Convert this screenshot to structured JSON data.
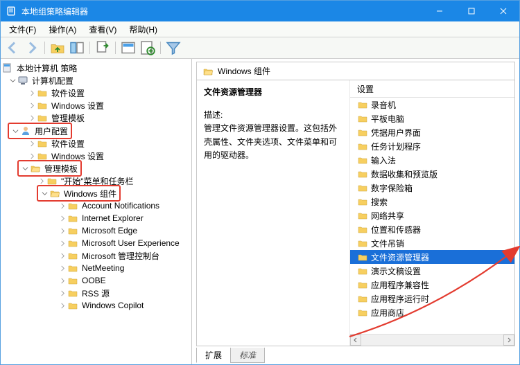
{
  "title": "本地组策略编辑器",
  "menu": {
    "file": "文件(F)",
    "action": "操作(A)",
    "view": "查看(V)",
    "help": "帮助(H)"
  },
  "tree": {
    "root": "本地计算机 策略",
    "computer": "计算机配置",
    "c_software": "软件设置",
    "c_windows": "Windows 设置",
    "c_admin": "管理模板",
    "user": "用户配置",
    "u_software": "软件设置",
    "u_windows": "Windows 设置",
    "u_admin": "管理模板",
    "start": "\"开始\"菜单和任务栏",
    "wincomp": "Windows 组件",
    "items": [
      "Account Notifications",
      "Internet Explorer",
      "Microsoft Edge",
      "Microsoft User Experience",
      "Microsoft 管理控制台",
      "NetMeeting",
      "OOBE",
      "RSS 源",
      "Windows Copilot"
    ]
  },
  "right": {
    "heading": "Windows 组件",
    "strong": "文件资源管理器",
    "desc_label": "描述:",
    "desc_text": "管理文件资源管理器设置。这包括外壳属性、文件夹选项、文件菜单和可用的驱动器。",
    "col": "设置",
    "selected_index": 11,
    "items": [
      "录音机",
      "平板电脑",
      "凭据用户界面",
      "任务计划程序",
      "输入法",
      "数据收集和预览版",
      "数字保险箱",
      "搜索",
      "网络共享",
      "位置和传感器",
      "文件吊销",
      "文件资源管理器",
      "演示文稿设置",
      "应用程序兼容性",
      "应用程序运行时",
      "应用商店"
    ]
  },
  "tabs": {
    "ext": "扩展",
    "std": "标准"
  }
}
